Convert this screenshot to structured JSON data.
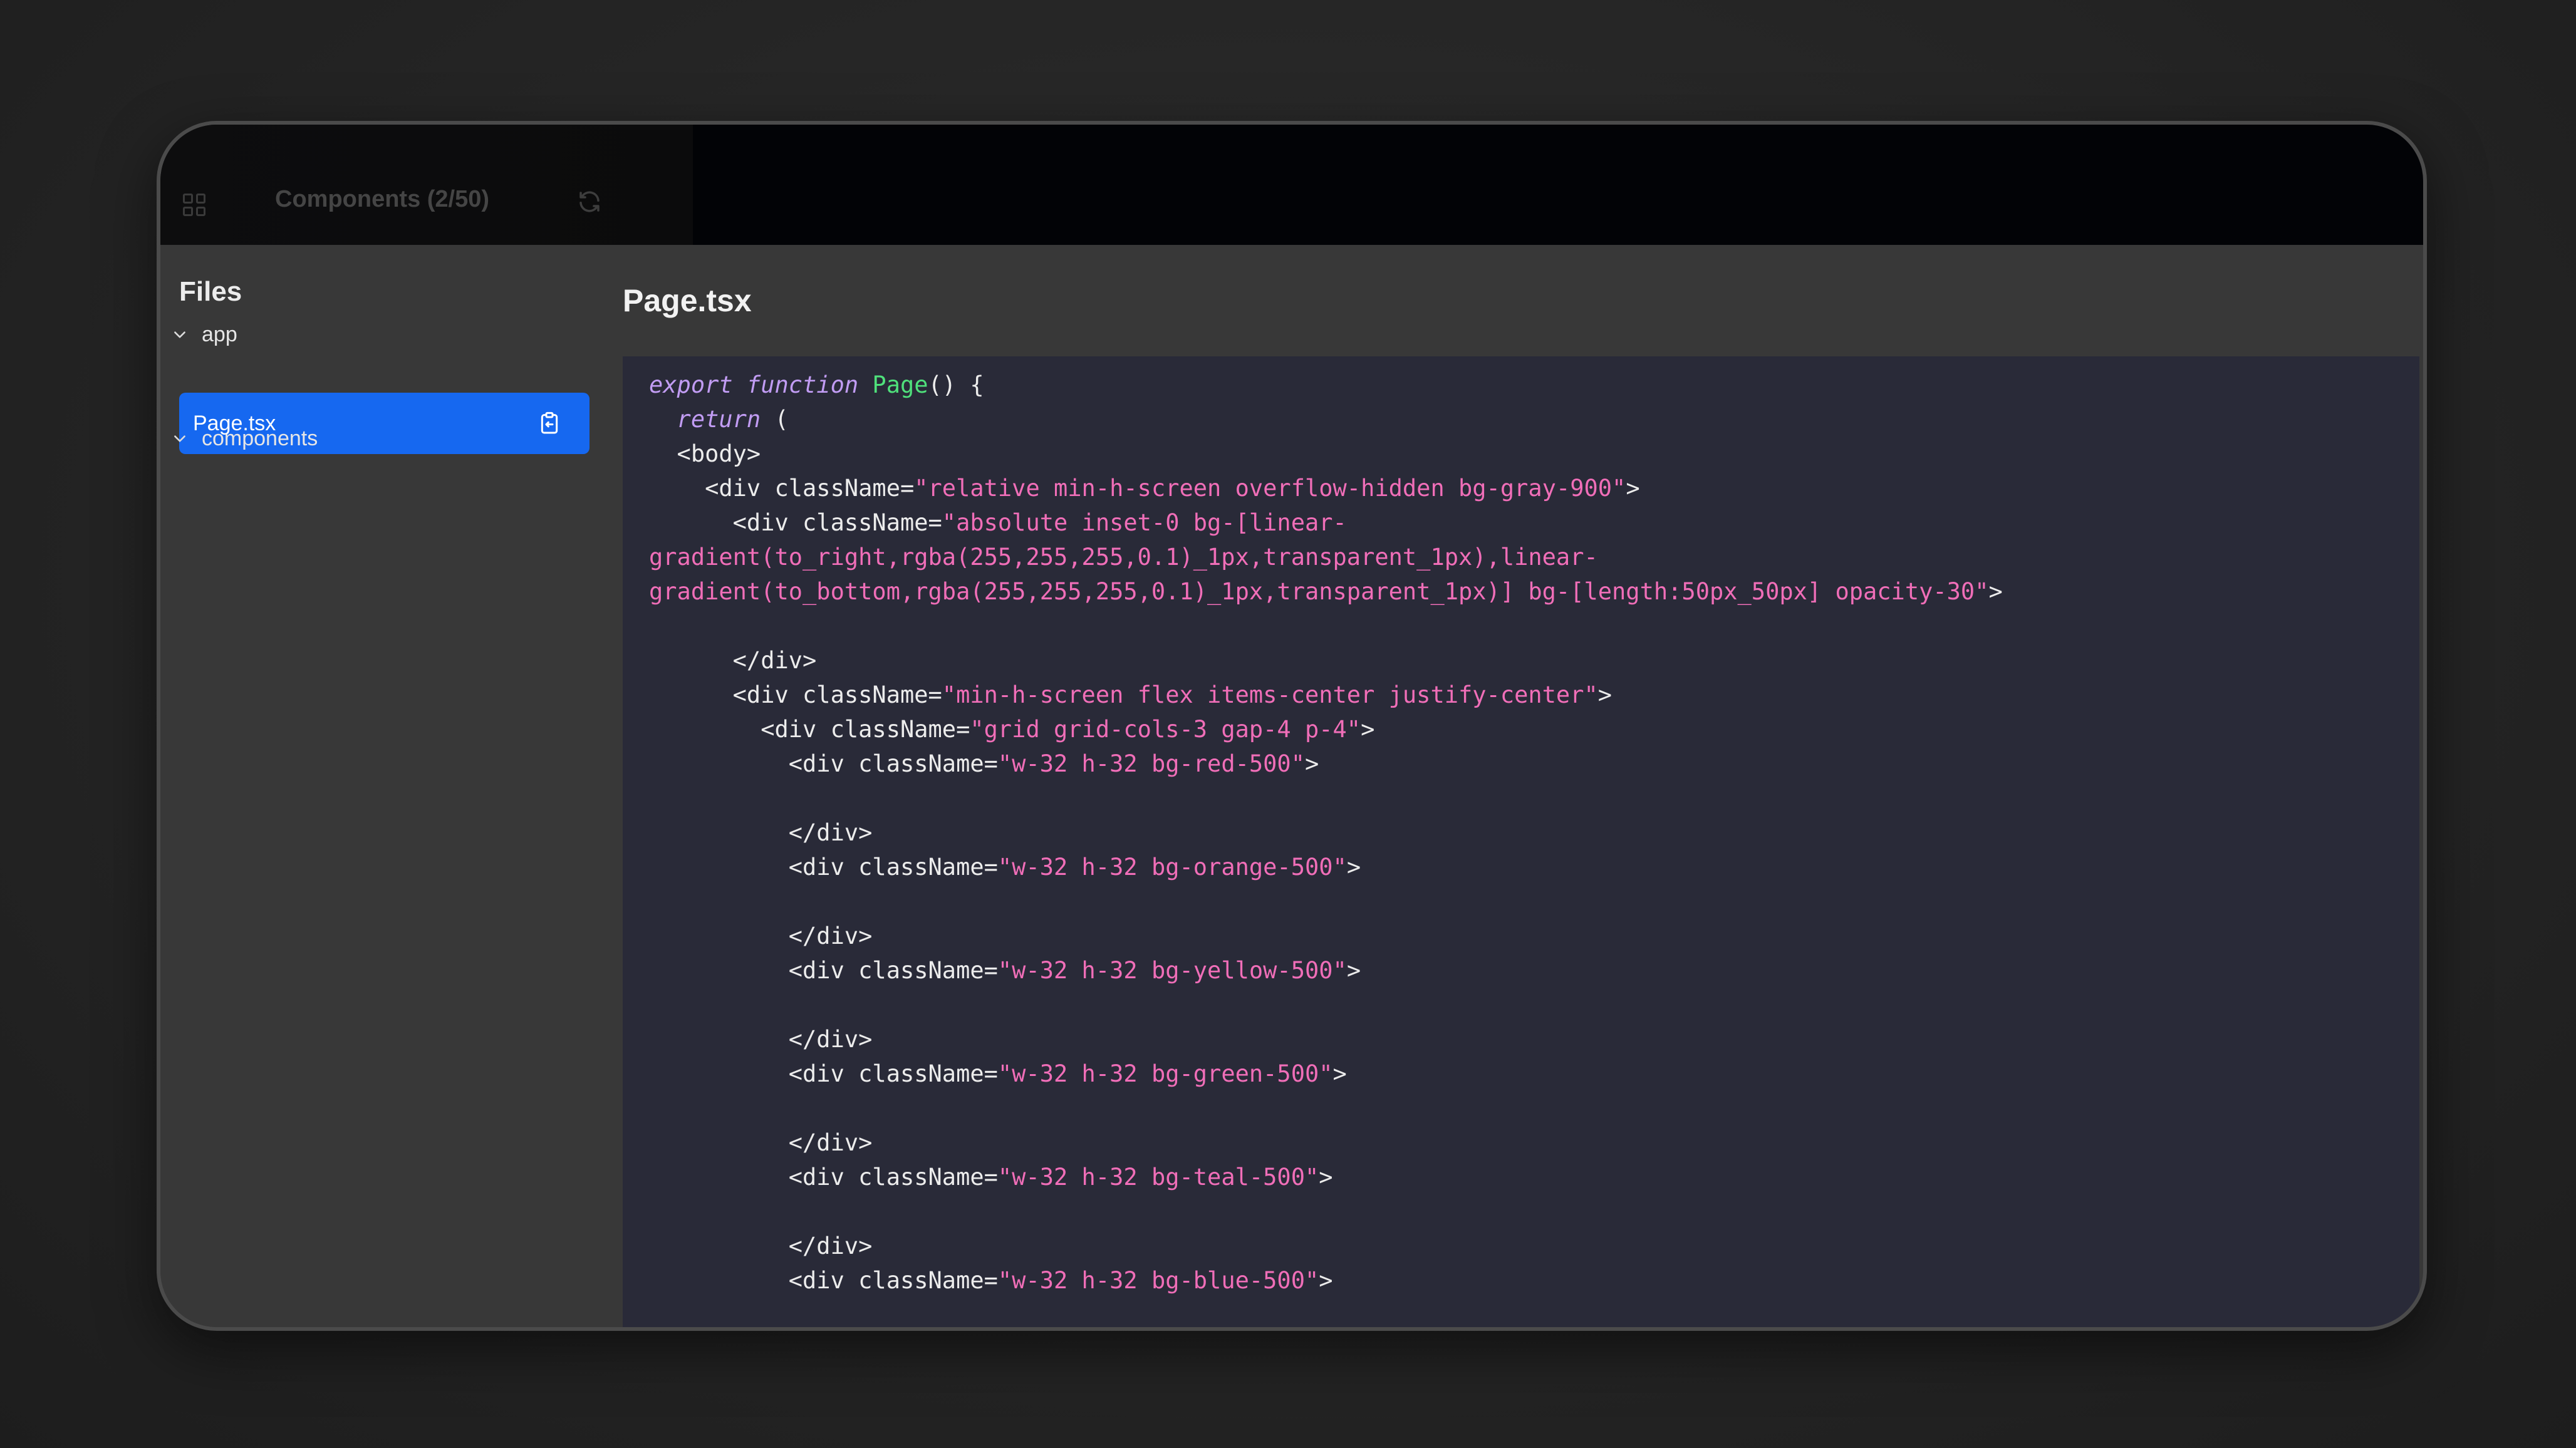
{
  "topbar": {
    "title": "Components (2/50)",
    "grid_icon": "grid-icon",
    "refresh_icon": "refresh-icon"
  },
  "sidebar": {
    "heading": "Files",
    "folders": [
      {
        "name": "app",
        "expanded": true
      },
      {
        "name": "components",
        "expanded": true
      }
    ],
    "selected_file": {
      "name": "Page.tsx",
      "icon": "copy-icon"
    }
  },
  "editor": {
    "filename": "Page.tsx",
    "lines": [
      [
        {
          "t": "kw",
          "v": "export function "
        },
        {
          "t": "fn",
          "v": "Page"
        },
        {
          "t": "tag",
          "v": "() {"
        }
      ],
      [
        {
          "t": "kw",
          "v": "  return "
        },
        {
          "t": "tag",
          "v": "("
        }
      ],
      [
        {
          "t": "tag",
          "v": "  <body>"
        }
      ],
      [
        {
          "t": "tag",
          "v": "    <div className="
        },
        {
          "t": "str",
          "v": "\"relative min-h-screen overflow-hidden bg-gray-900\""
        },
        {
          "t": "tag",
          "v": ">"
        }
      ],
      [
        {
          "t": "tag",
          "v": "      <div className="
        },
        {
          "t": "str",
          "v": "\"absolute inset-0 bg-[linear-"
        }
      ],
      [
        {
          "t": "str",
          "v": "gradient(to_right,rgba(255,255,255,0.1)_1px,transparent_1px),linear-"
        }
      ],
      [
        {
          "t": "str",
          "v": "gradient(to_bottom,rgba(255,255,255,0.1)_1px,transparent_1px)] bg-[length:50px_50px] opacity-30\""
        },
        {
          "t": "tag",
          "v": ">"
        }
      ],
      [
        {
          "t": "tag",
          "v": ""
        }
      ],
      [
        {
          "t": "tag",
          "v": "      </div>"
        }
      ],
      [
        {
          "t": "tag",
          "v": "      <div className="
        },
        {
          "t": "str",
          "v": "\"min-h-screen flex items-center justify-center\""
        },
        {
          "t": "tag",
          "v": ">"
        }
      ],
      [
        {
          "t": "tag",
          "v": "        <div className="
        },
        {
          "t": "str",
          "v": "\"grid grid-cols-3 gap-4 p-4\""
        },
        {
          "t": "tag",
          "v": ">"
        }
      ],
      [
        {
          "t": "tag",
          "v": "          <div className="
        },
        {
          "t": "str",
          "v": "\"w-32 h-32 bg-red-500\""
        },
        {
          "t": "tag",
          "v": ">"
        }
      ],
      [
        {
          "t": "tag",
          "v": ""
        }
      ],
      [
        {
          "t": "tag",
          "v": "          </div>"
        }
      ],
      [
        {
          "t": "tag",
          "v": "          <div className="
        },
        {
          "t": "str",
          "v": "\"w-32 h-32 bg-orange-500\""
        },
        {
          "t": "tag",
          "v": ">"
        }
      ],
      [
        {
          "t": "tag",
          "v": ""
        }
      ],
      [
        {
          "t": "tag",
          "v": "          </div>"
        }
      ],
      [
        {
          "t": "tag",
          "v": "          <div className="
        },
        {
          "t": "str",
          "v": "\"w-32 h-32 bg-yellow-500\""
        },
        {
          "t": "tag",
          "v": ">"
        }
      ],
      [
        {
          "t": "tag",
          "v": ""
        }
      ],
      [
        {
          "t": "tag",
          "v": "          </div>"
        }
      ],
      [
        {
          "t": "tag",
          "v": "          <div className="
        },
        {
          "t": "str",
          "v": "\"w-32 h-32 bg-green-500\""
        },
        {
          "t": "tag",
          "v": ">"
        }
      ],
      [
        {
          "t": "tag",
          "v": ""
        }
      ],
      [
        {
          "t": "tag",
          "v": "          </div>"
        }
      ],
      [
        {
          "t": "tag",
          "v": "          <div className="
        },
        {
          "t": "str",
          "v": "\"w-32 h-32 bg-teal-500\""
        },
        {
          "t": "tag",
          "v": ">"
        }
      ],
      [
        {
          "t": "tag",
          "v": ""
        }
      ],
      [
        {
          "t": "tag",
          "v": "          </div>"
        }
      ],
      [
        {
          "t": "tag",
          "v": "          <div className="
        },
        {
          "t": "str",
          "v": "\"w-32 h-32 bg-blue-500\""
        },
        {
          "t": "tag",
          "v": ">"
        }
      ]
    ]
  },
  "colors": {
    "selected_file_bg": "#1668f0",
    "code_bg": "#292a38",
    "keyword": "#c19cf3",
    "function": "#4fe07b",
    "string": "#f06eb8"
  }
}
